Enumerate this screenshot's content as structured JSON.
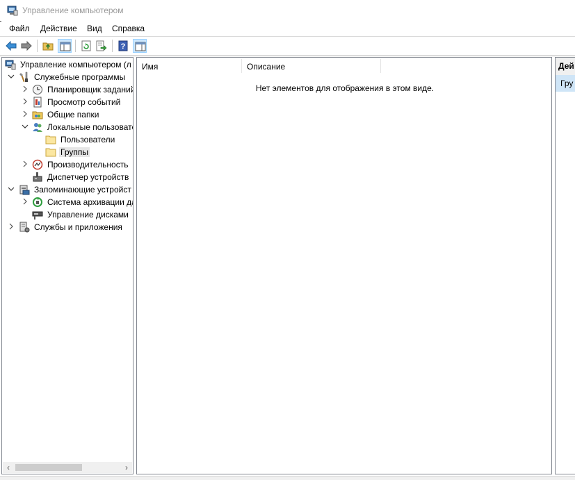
{
  "window": {
    "title": "Управление компьютером"
  },
  "menu": [
    "Файл",
    "Действие",
    "Вид",
    "Справка"
  ],
  "toolbar": {
    "buttons": [
      "back-icon",
      "forward-icon",
      "up-folder-icon",
      "show-hide-tree-icon",
      "refresh-icon",
      "export-list-icon",
      "help-icon",
      "show-hide-action-pane-icon"
    ]
  },
  "tree": {
    "root": "Управление компьютером (л",
    "system_tools": "Служебные программы",
    "task_scheduler": "Планировщик заданий",
    "event_viewer": "Просмотр событий",
    "shared_folders": "Общие папки",
    "local_users": "Локальные пользовате",
    "users": "Пользователи",
    "groups": "Группы",
    "performance": "Производительность",
    "device_manager": "Диспетчер устройств",
    "storage": "Запоминающие устройст",
    "backup": "Система архивации да",
    "disk_management": "Управление дисками",
    "services_apps": "Службы и приложения"
  },
  "list": {
    "columns": [
      "Имя",
      "Описание"
    ],
    "empty_message": "Нет элементов для отображения в этом виде."
  },
  "actions": {
    "header": "Дей",
    "item": "Гру"
  }
}
